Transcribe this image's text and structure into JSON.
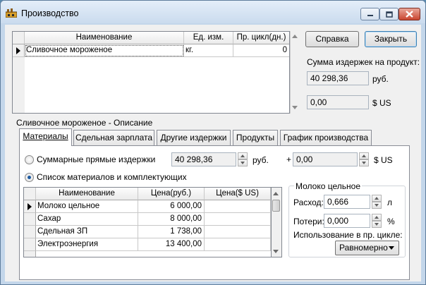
{
  "window": {
    "title": "Производство"
  },
  "products": {
    "columns": [
      "Наименование",
      "Ед. изм.",
      "Пр. цикл(дн.)"
    ],
    "rows": [
      {
        "name": "Сливочное мороженое",
        "unit": "кг.",
        "cycle": "0"
      }
    ]
  },
  "buttons": {
    "help": "Справка",
    "close": "Закрыть"
  },
  "summary": {
    "label": "Сумма издержек на продукт:",
    "rub_value": "40 298,36",
    "rub_unit": "руб.",
    "usd_value": "0,00",
    "usd_unit": "$ US"
  },
  "description_title": "Сливочное мороженое - Описание",
  "tabs": [
    "Материалы",
    "Сдельная зарплата",
    "Другие издержки",
    "Продукты",
    "График производства"
  ],
  "materials": {
    "option_total": {
      "label": "Суммарные прямые издержки",
      "rub_value": "40 298,36",
      "rub_unit": "руб.",
      "plus": "+",
      "usd_value": "0,00",
      "usd_unit": "$ US"
    },
    "option_list": {
      "label": "Список материалов и комплектующих"
    },
    "table": {
      "columns": [
        "Наименование",
        "Цена(руб.)",
        "Цена($ US)"
      ],
      "rows": [
        {
          "name": "Молоко цельное",
          "price_rub": "6 000,00",
          "price_usd": ""
        },
        {
          "name": "Сахар",
          "price_rub": "8 000,00",
          "price_usd": ""
        },
        {
          "name": "Сдельная ЗП",
          "price_rub": "1 738,00",
          "price_usd": ""
        },
        {
          "name": "Электроэнергия",
          "price_rub": "13 400,00",
          "price_usd": ""
        }
      ]
    },
    "detail": {
      "title": "Молоко цельное",
      "consumption_label": "Расход:",
      "consumption_value": "0,666",
      "consumption_unit": "л",
      "loss_label": "Потери:",
      "loss_value": "0,000",
      "loss_unit": "%",
      "usage_label": "Использование в пр. цикле:",
      "usage_value": "Равномерно"
    }
  }
}
